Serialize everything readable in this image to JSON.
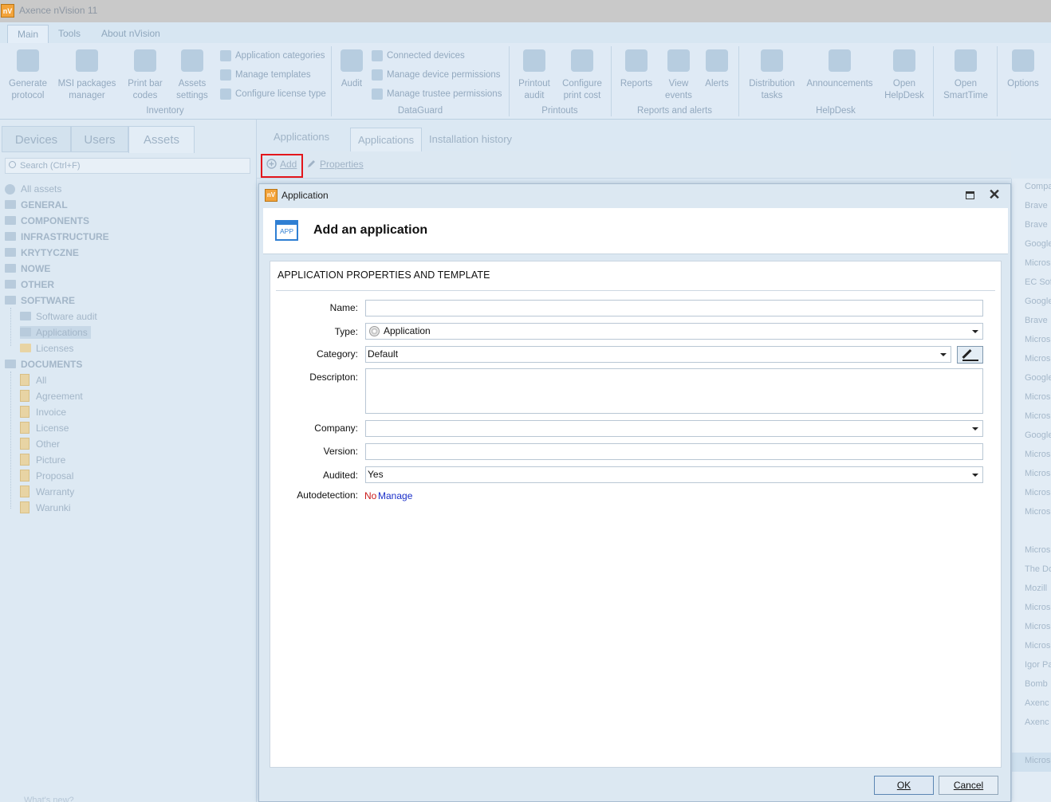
{
  "app": {
    "title": "Axence nVision 11",
    "logo_text": "nV"
  },
  "ribbon_tabs": [
    "Main",
    "Tools",
    "About nVision"
  ],
  "ribbon": {
    "buttons": [
      {
        "label": "Generate protocol",
        "icon": "server-stack-icon"
      },
      {
        "label": "MSI packages manager",
        "icon": "package-gear-icon"
      },
      {
        "label": "Print bar codes",
        "icon": "printer-icon"
      },
      {
        "label": "Assets settings",
        "icon": "cubes-gear-icon"
      },
      {
        "label": "Audit",
        "icon": "usb-audit-icon"
      },
      {
        "label": "Printout audit",
        "icon": "printer-search-icon"
      },
      {
        "label": "Configure print cost",
        "icon": "printer-gear-icon"
      },
      {
        "label": "Reports",
        "icon": "clipboard-icon"
      },
      {
        "label": "View events",
        "icon": "book-icon"
      },
      {
        "label": "Alerts",
        "icon": "globe-bell-icon"
      },
      {
        "label": "Distribution tasks",
        "icon": "network-icon"
      },
      {
        "label": "Announcements",
        "icon": "speech-bubble-icon"
      },
      {
        "label": "Open HelpDesk",
        "icon": "lifebuoy-icon"
      },
      {
        "label": "Open SmartTime",
        "icon": "speedometer-icon"
      },
      {
        "label": "Options",
        "icon": "gears-icon"
      }
    ],
    "small_buttons": [
      "Application categories",
      "Manage templates",
      "Configure license type",
      "Connected devices",
      "Manage device permissions",
      "Manage trustee permissions"
    ],
    "groups": [
      "Inventory",
      "DataGuard",
      "Printouts",
      "Reports and alerts",
      "HelpDesk"
    ]
  },
  "left": {
    "tabs": [
      "Devices",
      "Users",
      "Assets"
    ],
    "search_placeholder": "Search (Ctrl+F)",
    "tree": [
      {
        "label": "All assets",
        "bold": false
      },
      {
        "label": "GENERAL",
        "bold": true
      },
      {
        "label": "COMPONENTS",
        "bold": true
      },
      {
        "label": "INFRASTRUCTURE",
        "bold": true
      },
      {
        "label": "KRYTYCZNE",
        "bold": true
      },
      {
        "label": "NOWE",
        "bold": true
      },
      {
        "label": "OTHER",
        "bold": true
      },
      {
        "label": "SOFTWARE",
        "bold": true
      },
      {
        "label": "Software audit",
        "bold": false
      },
      {
        "label": "Applications",
        "bold": false
      },
      {
        "label": "Licenses",
        "bold": false
      },
      {
        "label": "DOCUMENTS",
        "bold": true
      },
      {
        "label": "All",
        "bold": false
      },
      {
        "label": "Agreement",
        "bold": false
      },
      {
        "label": "Invoice",
        "bold": false
      },
      {
        "label": "License",
        "bold": false
      },
      {
        "label": "Other",
        "bold": false
      },
      {
        "label": "Picture",
        "bold": false
      },
      {
        "label": "Proposal",
        "bold": false
      },
      {
        "label": "Warranty",
        "bold": false
      },
      {
        "label": "Warunki",
        "bold": false
      }
    ],
    "footer": "What's new?"
  },
  "main": {
    "header_label": "Applications",
    "tabs": [
      "Applications",
      "Installation history"
    ],
    "toolbar": {
      "add": "Add",
      "properties": "Properties"
    },
    "right_list": [
      "Compa",
      "Brave",
      "Brave",
      "Google",
      "Micros",
      "EC Sof",
      "Google",
      "Brave",
      "Micros",
      "Micros",
      "Google",
      "Micros",
      "Micros",
      "Google",
      "Micros",
      "Micros",
      "Micros",
      "Micros",
      "",
      "Micros",
      "The Do",
      "Mozill",
      "Micros",
      "Micros",
      "Micros",
      "Igor Pa",
      "Bomb",
      "Axenc",
      "Axenc",
      "",
      "Micros"
    ]
  },
  "dialog": {
    "title": "Application",
    "logo_text": "nV",
    "header_title": "Add an application",
    "header_icon_text": "APP",
    "section_title": "APPLICATION PROPERTIES AND TEMPLATE",
    "fields": {
      "name": {
        "label": "Name:",
        "value": ""
      },
      "type": {
        "label": "Type:",
        "value": "Application"
      },
      "category": {
        "label": "Category:",
        "value": "Default"
      },
      "description": {
        "label": "Descripton:",
        "value": ""
      },
      "company": {
        "label": "Company:",
        "value": ""
      },
      "version": {
        "label": "Version:",
        "value": ""
      },
      "audited": {
        "label": "Audited:",
        "value": "Yes"
      },
      "autodetection": {
        "label": "Autodetection:",
        "value": "No",
        "link": "Manage"
      }
    },
    "buttons": {
      "ok": "OK",
      "cancel": "Cancel"
    }
  },
  "colors": {
    "highlight_box": "#e3161b",
    "dialog_accent": "#2f7fd3",
    "autodetection_no": "#c91a1a",
    "manage_link": "#1a2fc9"
  }
}
